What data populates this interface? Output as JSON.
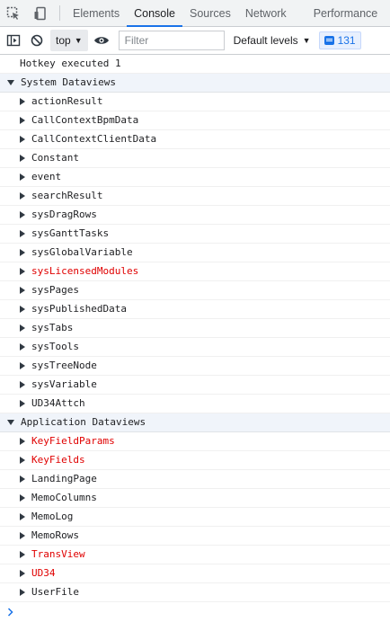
{
  "tabs": [
    "Elements",
    "Console",
    "Sources",
    "Network",
    "Performance"
  ],
  "toolbar": {
    "context": "top",
    "filter_placeholder": "Filter",
    "levels": "Default levels",
    "message_count": "131"
  },
  "console": {
    "log_line": "Hotkey executed 1",
    "groups": [
      {
        "title": "System Dataviews",
        "items": [
          {
            "label": "actionResult",
            "error": false
          },
          {
            "label": "CallContextBpmData",
            "error": false
          },
          {
            "label": "CallContextClientData",
            "error": false
          },
          {
            "label": "Constant",
            "error": false
          },
          {
            "label": "event",
            "error": false
          },
          {
            "label": "searchResult",
            "error": false
          },
          {
            "label": "sysDragRows",
            "error": false
          },
          {
            "label": "sysGanttTasks",
            "error": false
          },
          {
            "label": "sysGlobalVariable",
            "error": false
          },
          {
            "label": "sysLicensedModules",
            "error": true
          },
          {
            "label": "sysPages",
            "error": false
          },
          {
            "label": "sysPublishedData",
            "error": false
          },
          {
            "label": "sysTabs",
            "error": false
          },
          {
            "label": "sysTools",
            "error": false
          },
          {
            "label": "sysTreeNode",
            "error": false
          },
          {
            "label": "sysVariable",
            "error": false
          },
          {
            "label": "UD34Attch",
            "error": false
          }
        ]
      },
      {
        "title": "Application Dataviews",
        "items": [
          {
            "label": "KeyFieldParams",
            "error": true
          },
          {
            "label": "KeyFields",
            "error": true
          },
          {
            "label": "LandingPage",
            "error": false
          },
          {
            "label": "MemoColumns",
            "error": false
          },
          {
            "label": "MemoLog",
            "error": false
          },
          {
            "label": "MemoRows",
            "error": false
          },
          {
            "label": "TransView",
            "error": true
          },
          {
            "label": "UD34",
            "error": true
          },
          {
            "label": "UserFile",
            "error": false
          }
        ]
      }
    ]
  },
  "colors": {
    "accent": "#1a73e8",
    "error_text": "#e00000"
  }
}
